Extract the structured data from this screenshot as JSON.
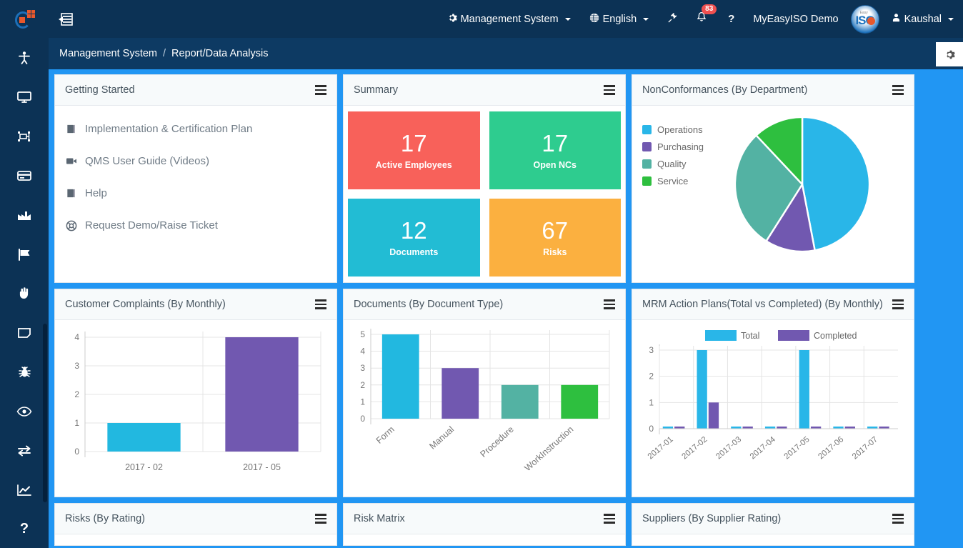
{
  "topbar": {
    "logo_name": "app-logo",
    "menu_toggle": "sidebar-toggle",
    "management_system": "Management System",
    "language": "English",
    "pin_icon": "pin-icon",
    "bell_count": "83",
    "help": "?",
    "org_name": "MyEasyISO Demo",
    "iso_text": "ISO",
    "iso_tiny": "Easy",
    "user": "Kaushal"
  },
  "breadcrumb": {
    "root": "Management System",
    "separator": "/",
    "current": "Report/Data Analysis",
    "gear": "settings-gear"
  },
  "sidebar": {
    "items": [
      {
        "name": "sidebar-item-user",
        "icon": "person-raise-icon"
      },
      {
        "name": "sidebar-item-dashboard",
        "icon": "monitor-icon"
      },
      {
        "name": "sidebar-item-process",
        "icon": "process-map-icon"
      },
      {
        "name": "sidebar-item-card",
        "icon": "card-icon"
      },
      {
        "name": "sidebar-item-factory",
        "icon": "factory-icon"
      },
      {
        "name": "sidebar-item-flag",
        "icon": "flag-icon"
      },
      {
        "name": "sidebar-item-hand",
        "icon": "hand-icon"
      },
      {
        "name": "sidebar-item-note",
        "icon": "note-icon"
      },
      {
        "name": "sidebar-item-bug",
        "icon": "bug-icon"
      },
      {
        "name": "sidebar-item-eye",
        "icon": "eye-icon"
      },
      {
        "name": "sidebar-item-transfer",
        "icon": "exchange-icon"
      },
      {
        "name": "sidebar-item-analytics",
        "icon": "line-chart-icon"
      },
      {
        "name": "sidebar-item-help",
        "icon": "question-icon"
      }
    ]
  },
  "panels": {
    "getting_started": {
      "title": "Getting Started",
      "items": [
        {
          "label": "Implementation & Certification Plan",
          "icon": "book-icon"
        },
        {
          "label": "QMS User Guide (Videos)",
          "icon": "video-icon"
        },
        {
          "label": "Help",
          "icon": "book-icon"
        },
        {
          "label": "Request Demo/Raise Ticket",
          "icon": "lifebuoy-icon"
        }
      ]
    },
    "summary": {
      "title": "Summary",
      "tiles": [
        {
          "value": "17",
          "label": "Active Employees",
          "color": "#f8615a"
        },
        {
          "value": "17",
          "label": "Open NCs",
          "color": "#2ecc8f"
        },
        {
          "value": "12",
          "label": "Documents",
          "color": "#22bcd4"
        },
        {
          "value": "67",
          "label": "Risks",
          "color": "#fbb040"
        }
      ]
    },
    "nonconformances": {
      "title": "NonConformances (By Department)"
    },
    "customer_complaints": {
      "title": "Customer Complaints (By Monthly)"
    },
    "documents": {
      "title": "Documents (By Document Type)"
    },
    "mrm": {
      "title": "MRM Action Plans(Total vs Completed) (By Monthly)"
    },
    "risks_by_rating": {
      "title": "Risks (By Rating)"
    },
    "risk_matrix": {
      "title": "Risk Matrix"
    },
    "suppliers": {
      "title": "Suppliers (By Supplier Rating)"
    }
  },
  "chart_data": [
    {
      "id": "nonconformances-pie",
      "type": "pie",
      "title": "NonConformances (By Department)",
      "legend_position": "left",
      "labels": [
        "Operations",
        "Purchasing",
        "Quality",
        "Service"
      ],
      "values": [
        47,
        12,
        29,
        12
      ],
      "colors": [
        "#29b6e8",
        "#7158b0",
        "#53b2a3",
        "#2ebf3f"
      ]
    },
    {
      "id": "customer-complaints-bar",
      "type": "bar",
      "title": "Customer Complaints (By Monthly)",
      "categories": [
        "2017 - 02",
        "2017 - 05"
      ],
      "values": [
        1,
        4
      ],
      "colors": [
        "#22b8e0",
        "#7158b0"
      ],
      "xlabel": "",
      "ylabel": "",
      "ylim": [
        0,
        4
      ],
      "yticks": [
        0,
        1,
        2,
        3,
        4
      ],
      "grid": true
    },
    {
      "id": "documents-bar",
      "type": "bar",
      "title": "Documents (By Document Type)",
      "categories": [
        "Form",
        "Manual",
        "Procedure",
        "WorkInstruction"
      ],
      "values": [
        5,
        3,
        2,
        2
      ],
      "colors": [
        "#22b8e0",
        "#7158b0",
        "#53b2a3",
        "#2ebf3f"
      ],
      "xlabel": "",
      "ylabel": "",
      "ylim": [
        0,
        5
      ],
      "yticks": [
        0,
        1,
        2,
        3,
        4,
        5
      ],
      "grid": true
    },
    {
      "id": "mrm-grouped-bar",
      "type": "bar",
      "title": "MRM Action Plans(Total vs Completed) (By Monthly)",
      "categories": [
        "2017-01",
        "2017-02",
        "2017-03",
        "2017-04",
        "2017-05",
        "2017-06",
        "2017-07"
      ],
      "series": [
        {
          "name": "Total",
          "values": [
            0,
            3,
            0,
            0,
            3,
            0,
            0
          ],
          "color": "#29b6e8"
        },
        {
          "name": "Completed",
          "values": [
            0,
            1,
            0,
            0,
            0,
            0,
            0
          ],
          "color": "#7158b0"
        }
      ],
      "ylim": [
        0,
        3
      ],
      "yticks": [
        0,
        1,
        2,
        3
      ],
      "legend_position": "top",
      "grid": true
    }
  ]
}
